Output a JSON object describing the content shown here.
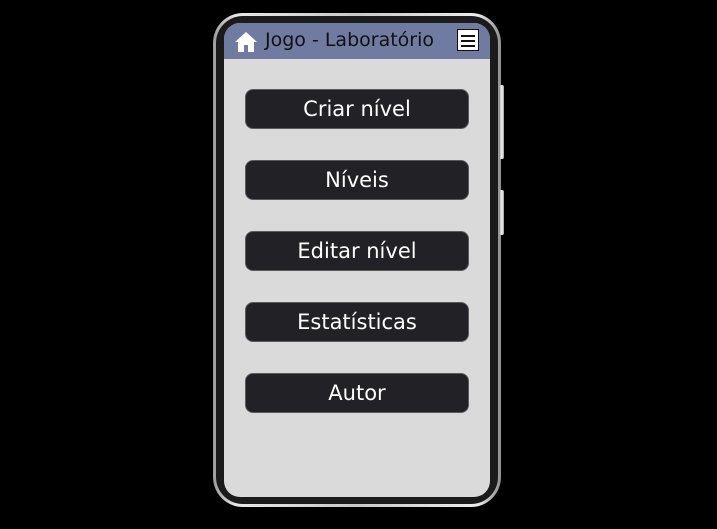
{
  "header": {
    "title": "Jogo - Laboratório",
    "home_icon": "home-icon",
    "menu_icon": "hamburger-menu-icon",
    "background_color": "#6f7ba0"
  },
  "menu": {
    "items": [
      {
        "label": "Criar nível"
      },
      {
        "label": "Níveis"
      },
      {
        "label": "Editar nível"
      },
      {
        "label": "Estatísticas"
      },
      {
        "label": "Autor"
      }
    ],
    "button_color": "#222226",
    "text_color": "#ffffff"
  },
  "screen": {
    "background_color": "#dadada"
  }
}
